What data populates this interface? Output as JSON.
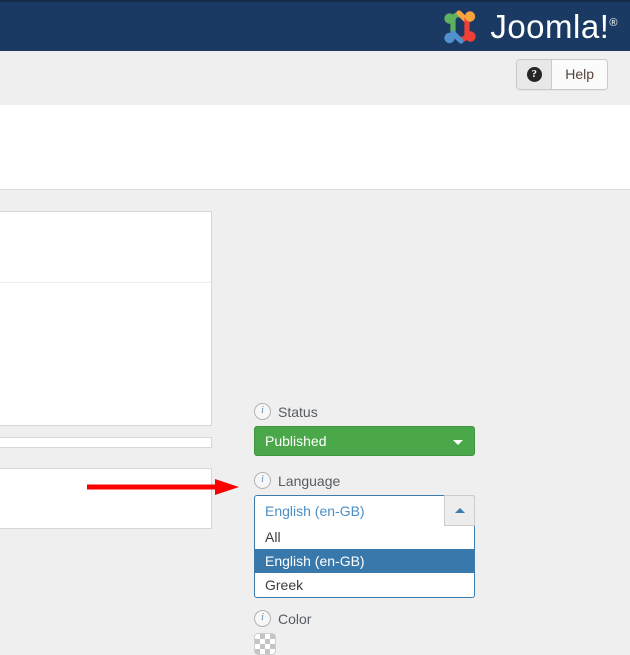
{
  "header": {
    "brand_name": "Joomla!",
    "brand_registered": "®",
    "logo_icon": "joomla-logo-icon"
  },
  "toolbar": {
    "help_label": "Help",
    "help_icon": "question-mark-icon",
    "help_icon_glyph": "?"
  },
  "annotation": {
    "arrow_icon": "red-arrow-right-icon",
    "arrow_color": "#fb0000"
  },
  "form": {
    "status": {
      "label": "Status",
      "info_icon": "info-icon",
      "info_glyph": "i",
      "value": "Published",
      "caret_icon": "caret-down-icon",
      "accent_color": "#4aa84a"
    },
    "language": {
      "label": "Language",
      "info_icon": "info-icon",
      "info_glyph": "i",
      "value": "English (en-GB)",
      "expanded": true,
      "caret_icon": "caret-up-icon",
      "accent_color": "#3878ab",
      "options": [
        {
          "label": "All",
          "selected": false
        },
        {
          "label": "English (en-GB)",
          "selected": true
        },
        {
          "label": "Greek",
          "selected": false
        }
      ]
    },
    "color": {
      "label": "Color",
      "info_icon": "info-icon",
      "info_glyph": "i",
      "swatch_icon": "transparent-checkerboard-swatch",
      "value": ""
    }
  }
}
